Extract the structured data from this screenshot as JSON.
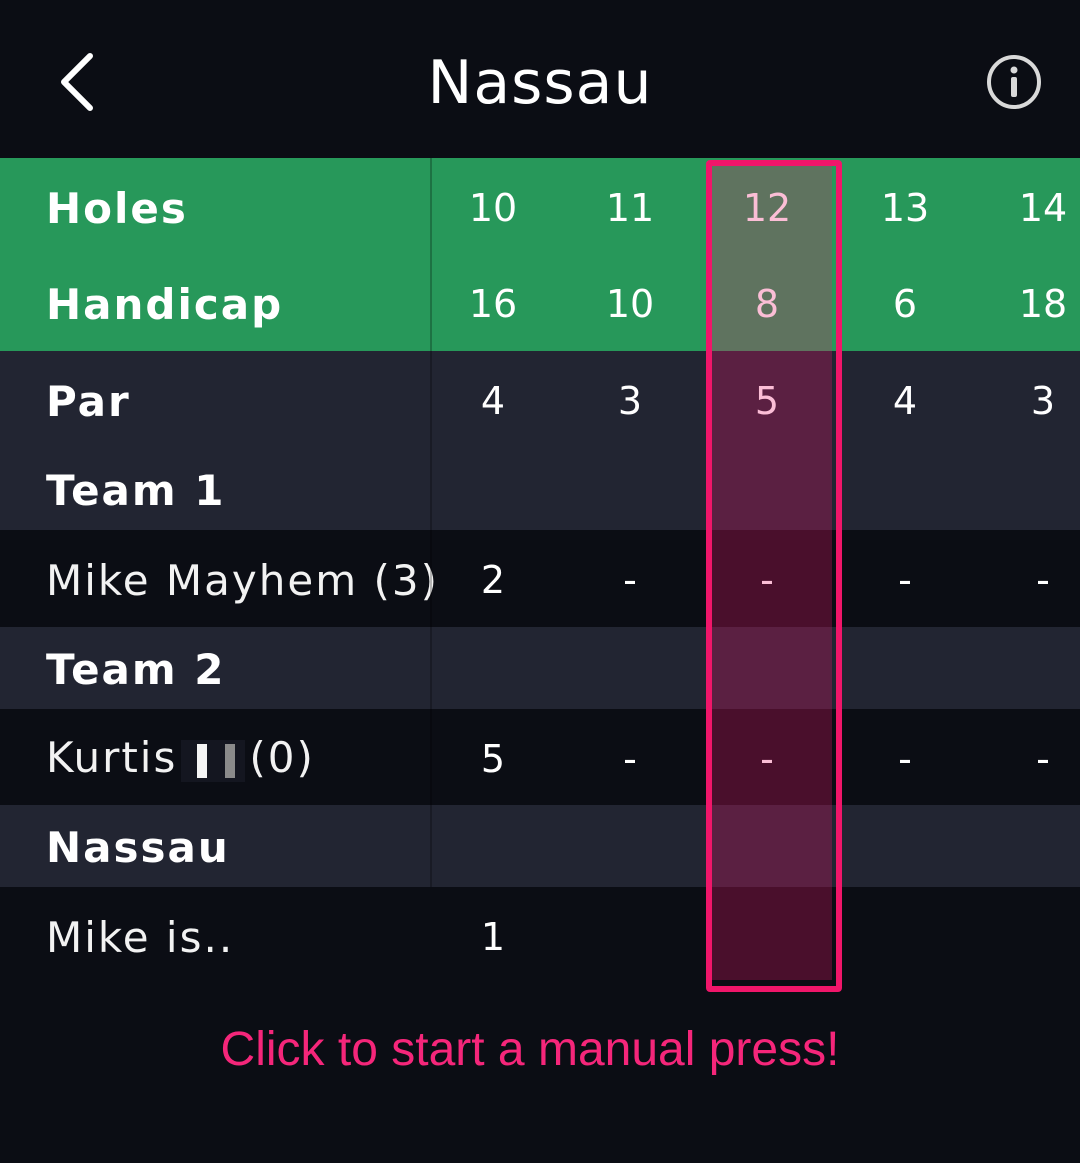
{
  "header": {
    "title": "Nassau",
    "back_icon": "chevron-left-icon",
    "info_icon": "info-circle-icon"
  },
  "colors": {
    "accent": "#f0166a",
    "header_green": "#27985a",
    "row_slate": "#222532",
    "background": "#0b0d14"
  },
  "scorecard": {
    "holes": {
      "label": "Holes",
      "values": [
        "10",
        "11",
        "12",
        "13",
        "14"
      ]
    },
    "handicap": {
      "label": "Handicap",
      "values": [
        "16",
        "10",
        "8",
        "6",
        "18"
      ]
    },
    "par": {
      "label": "Par",
      "values": [
        "4",
        "3",
        "5",
        "4",
        "3"
      ]
    },
    "team1": {
      "label": "Team 1"
    },
    "player1": {
      "name": "Mike Mayhem (3)",
      "scores": [
        "2",
        "-",
        "-",
        "-",
        "-"
      ]
    },
    "team2": {
      "label": "Team 2"
    },
    "player2": {
      "first_name": "Kurtis",
      "handicap": "(0)",
      "scores": [
        "5",
        "-",
        "-",
        "-",
        "-"
      ]
    },
    "nassau": {
      "label": "Nassau"
    },
    "result": {
      "label": "Mike is..",
      "values": [
        "1",
        "",
        "",
        "",
        ""
      ]
    }
  },
  "highlighted_hole": "12",
  "cta": {
    "label": "Click to start a manual press!"
  }
}
